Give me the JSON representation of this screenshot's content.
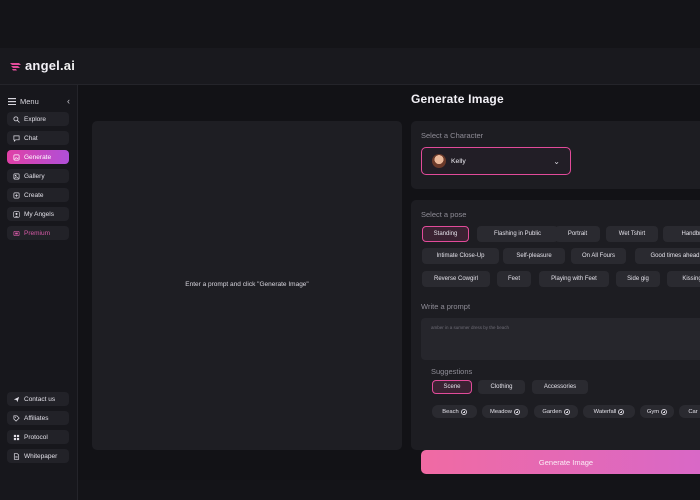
{
  "brand": {
    "name": "angel",
    "tld": ".ai",
    "accent": "#e24b9a"
  },
  "sidebar": {
    "menu_label": "Menu",
    "items": [
      {
        "label": "Explore",
        "icon": "search-icon"
      },
      {
        "label": "Chat",
        "icon": "chat-icon"
      },
      {
        "label": "Generate",
        "icon": "image-icon",
        "active": true
      },
      {
        "label": "Gallery",
        "icon": "gallery-icon"
      },
      {
        "label": "Create",
        "icon": "plus-square-icon"
      },
      {
        "label": "My Angels",
        "icon": "user-icon"
      },
      {
        "label": "Premium",
        "icon": "premium-icon"
      }
    ],
    "footer_items": [
      {
        "label": "Contact us",
        "icon": "send-icon"
      },
      {
        "label": "Affiliates",
        "icon": "tag-icon"
      },
      {
        "label": "Protocol",
        "icon": "grid-icon"
      },
      {
        "label": "Whitepaper",
        "icon": "document-icon"
      }
    ]
  },
  "main": {
    "title": "Generate Image",
    "preview_text": "Enter a prompt and click \"Generate Image\""
  },
  "character": {
    "label": "Select a Character",
    "selected": "Kelly"
  },
  "poses": {
    "label": "Select a pose",
    "rows": [
      [
        "Standing",
        "Flashing in Public",
        "Portrait",
        "Wet Tshirt",
        "Handbra"
      ],
      [
        "Intimate Close-Up",
        "Self-pleasure",
        "On All Fours",
        "Good times ahead"
      ],
      [
        "Reverse Cowgirl",
        "Feet",
        "Playing with Feet",
        "Side gig",
        "Kissing"
      ]
    ],
    "selected": "Standing"
  },
  "prompt": {
    "label": "Write a prompt",
    "placeholder": "amber in a summer dress by the beach"
  },
  "suggestions": {
    "label": "Suggestions",
    "tabs": [
      "Scene",
      "Clothing",
      "Accessories"
    ],
    "selected_tab": "Scene",
    "chips": [
      "Beach",
      "Meadow",
      "Garden",
      "Waterfall",
      "Gym",
      "Car"
    ]
  },
  "generate_button": "Generate Image"
}
